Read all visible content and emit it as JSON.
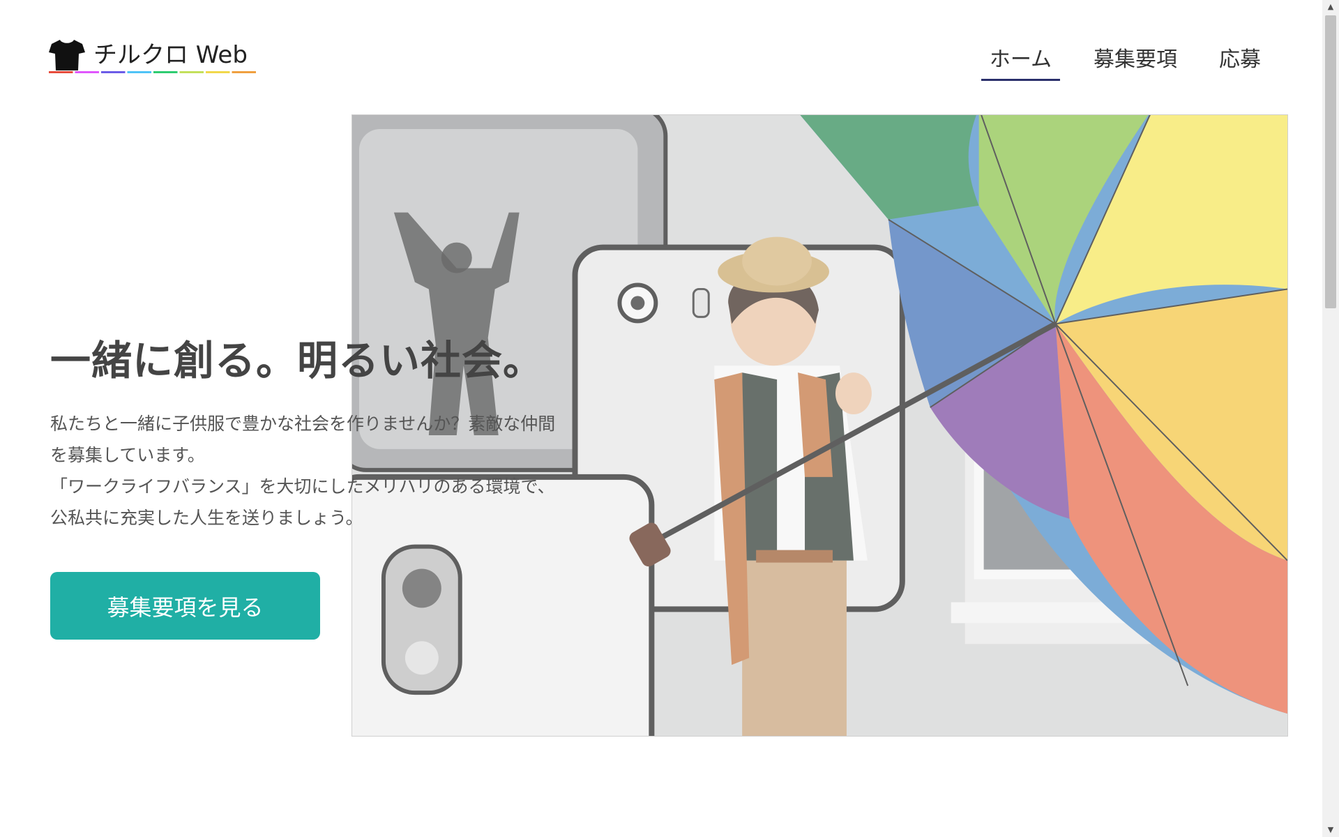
{
  "header": {
    "logo_text": "チルクロ Web",
    "logo_icon": "tshirt-icon",
    "logo_underline_colors": [
      "#e74c3c",
      "#e056fd",
      "#6c5ce7",
      "#4fc3f7",
      "#2ecc71",
      "#c3e05b",
      "#f1d84b",
      "#f0a040"
    ]
  },
  "nav": {
    "items": [
      {
        "label": "ホーム",
        "active": true
      },
      {
        "label": "募集要項",
        "active": false
      },
      {
        "label": "応募",
        "active": false
      }
    ],
    "active_underline_color": "#2a2f6b"
  },
  "hero": {
    "title": "一緒に創る。明るい社会。",
    "description_lines": [
      "私たちと一緒に子供服で豊かな社会を作りませんか？素敵な仲間を募集しています。",
      "「ワークライフバランス」を大切にしたメリハリのある環境で、公私共に充実した人生を送りましょう。"
    ],
    "cta_label": "募集要項を見る",
    "cta_color": "#20afa5",
    "image_alt": "boy-with-rainbow-umbrella-photo"
  }
}
